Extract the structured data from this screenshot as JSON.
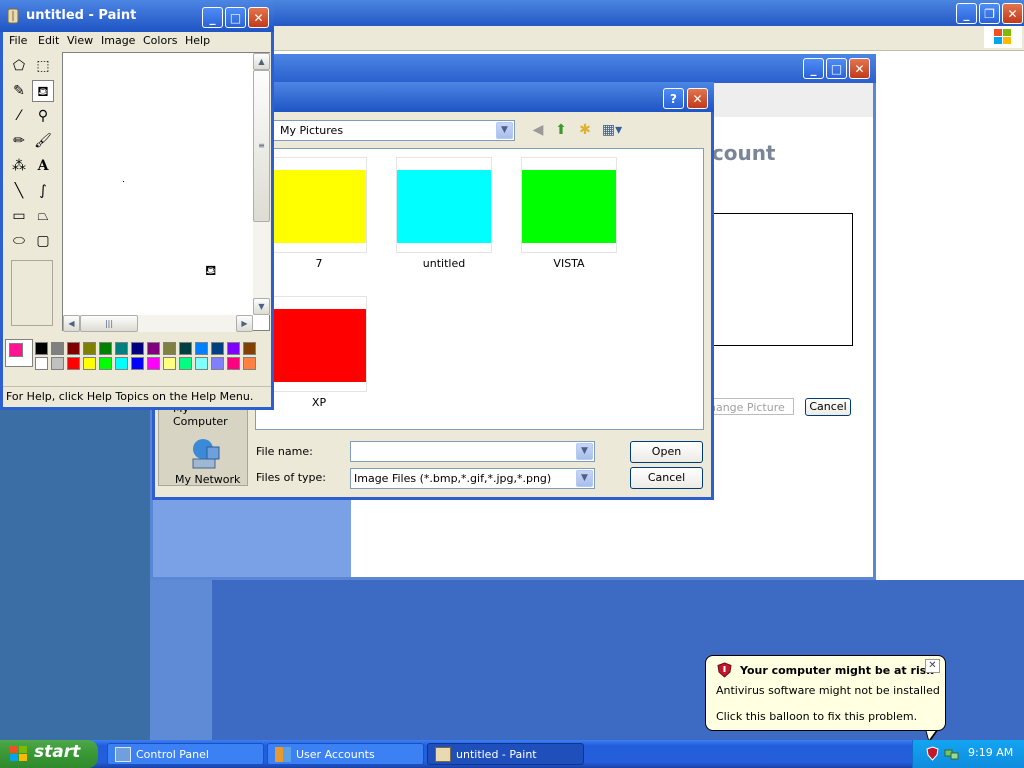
{
  "control_panel": {
    "taskbar_label": "Control Panel"
  },
  "user_accounts": {
    "taskbar_label": "User Accounts",
    "heading_fragment": "ccount",
    "change_picture_fragment": "hange Picture",
    "cancel_label": "Cancel"
  },
  "open_dialog": {
    "look_in": "My Pictures",
    "places": [
      {
        "label": "My Computer"
      },
      {
        "label": "My Network"
      }
    ],
    "files": [
      {
        "name": "7",
        "color": "#ffff00"
      },
      {
        "name": "untitled",
        "color": "#00ffff"
      },
      {
        "name": "VISTA",
        "color": "#00ff00"
      },
      {
        "name": "XP",
        "color": "#ff0000"
      }
    ],
    "file_name_label": "File name:",
    "file_name_value": "",
    "file_type_label": "Files of type:",
    "file_type_value": "Image Files (*.bmp,*.gif,*.jpg,*.png)",
    "open_label": "Open",
    "cancel_label": "Cancel"
  },
  "paint": {
    "title": "untitled - Paint",
    "menus": [
      "File",
      "Edit",
      "View",
      "Image",
      "Colors",
      "Help"
    ],
    "status": "For Help, click Help Topics on the Help Menu.",
    "foreground_color": "#ff1493",
    "background_color": "#ffffff",
    "palette_top": [
      "#000000",
      "#808080",
      "#800000",
      "#808000",
      "#008000",
      "#008080",
      "#000080",
      "#800080",
      "#808040",
      "#004040",
      "#0080ff",
      "#004080",
      "#8000ff",
      "#804000"
    ],
    "palette_bottom": [
      "#ffffff",
      "#c0c0c0",
      "#ff0000",
      "#ffff00",
      "#00ff00",
      "#00ffff",
      "#0000ff",
      "#ff00ff",
      "#ffff80",
      "#00ff80",
      "#80ffff",
      "#8080ff",
      "#ff0080",
      "#ff8040"
    ]
  },
  "balloon": {
    "title": "Your computer might be at risk",
    "line1": "Antivirus software might not be installed",
    "line2": "Click this balloon to fix this problem."
  },
  "taskbar": {
    "start_label": "start",
    "active_label": "untitled - Paint",
    "clock": "9:19 AM"
  }
}
